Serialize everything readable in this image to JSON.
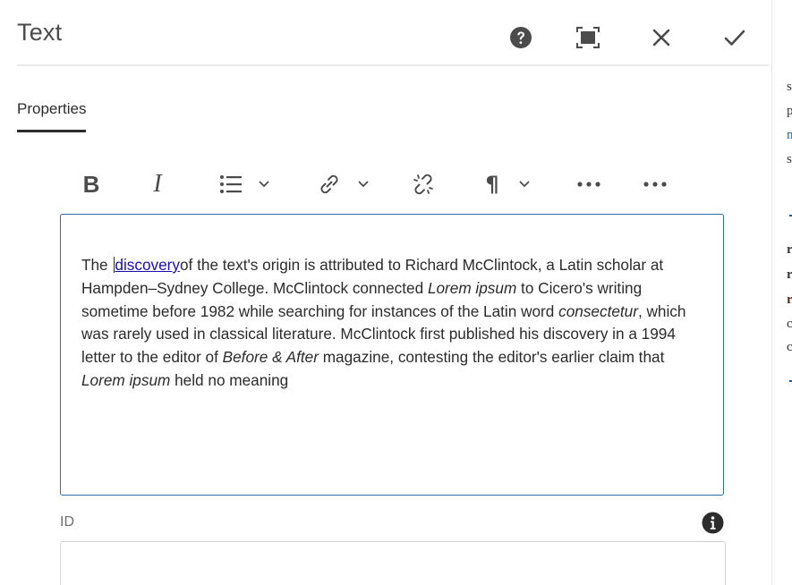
{
  "dialog": {
    "title": "Text",
    "header_buttons": {
      "help": "help-icon",
      "fullscreen": "fullscreen-icon",
      "cancel": "close-icon",
      "done": "checkmark-icon"
    }
  },
  "tabs": [
    {
      "label": "Properties",
      "selected": true
    }
  ],
  "toolbar": {
    "items": [
      "bold-icon",
      "italic-icon",
      "list-icon",
      "link-icon",
      "unlink-icon",
      "paragraph-icon",
      "more-icon",
      "more-icon"
    ],
    "bold_glyph": "B",
    "italic_glyph": "I",
    "paragraph_glyph": "¶"
  },
  "editor": {
    "segments": {
      "s1": "The ",
      "link": "discovery",
      "s2": "of the text's origin is attributed to Richard McClintock, a Latin scholar at Hampden–Sydney College. McClintock connected ",
      "em1": "Lorem ipsum",
      "s3": " to Cicero's writing sometime before 1982 while searching for instances of the Latin word ",
      "em2": "consectetur",
      "s4": ", which was rarely used in classical literature. McClintock first published his discovery in a 1994 letter to the editor of ",
      "em3": "Before & After",
      "s5": " magazine, contesting the editor's earlier claim that ",
      "em4": "Lorem ipsum",
      "s6": " held no meaning"
    }
  },
  "id_field": {
    "label": "ID",
    "value": "",
    "info_icon": "info-icon"
  },
  "colors": {
    "accent_border": "#2d6ea8",
    "link": "#1a0dab",
    "text": "#2c2c2c",
    "icon": "#4b4b4b"
  }
}
